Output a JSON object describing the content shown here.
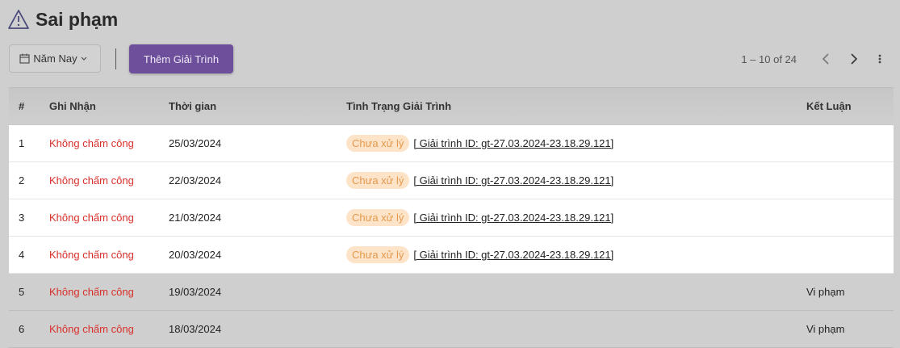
{
  "page": {
    "title": "Sai phạm"
  },
  "toolbar": {
    "year_filter": "Năm Nay",
    "add_button": "Thêm Giải Trình"
  },
  "pagination": {
    "range": "1 – 10 of 24"
  },
  "table": {
    "headers": [
      "#",
      "Ghi Nhận",
      "Thời gian",
      "Tình Trạng Giải Trình",
      "Kết Luận"
    ],
    "rows": [
      {
        "idx": "1",
        "note": "Không chấm công",
        "time": "25/03/2024",
        "status": "Chưa xử lý",
        "link": "[ Giải trình ID: gt-27.03.2024-23.18.29.121]",
        "conclusion": ""
      },
      {
        "idx": "2",
        "note": "Không chấm công",
        "time": "22/03/2024",
        "status": "Chưa xử lý",
        "link": "[ Giải trình ID: gt-27.03.2024-23.18.29.121]",
        "conclusion": ""
      },
      {
        "idx": "3",
        "note": "Không chấm công",
        "time": "21/03/2024",
        "status": "Chưa xử lý",
        "link": "[ Giải trình ID: gt-27.03.2024-23.18.29.121]",
        "conclusion": ""
      },
      {
        "idx": "4",
        "note": "Không chấm công",
        "time": "20/03/2024",
        "status": "Chưa xử lý",
        "link": "[ Giải trình ID: gt-27.03.2024-23.18.29.121]",
        "conclusion": ""
      },
      {
        "idx": "5",
        "note": "Không chấm công",
        "time": "19/03/2024",
        "status": "",
        "link": "",
        "conclusion": "Vi phạm"
      },
      {
        "idx": "6",
        "note": "Không chấm công",
        "time": "18/03/2024",
        "status": "",
        "link": "",
        "conclusion": "Vi phạm"
      }
    ]
  },
  "colors": {
    "accent": "#6e4f9c",
    "violation_text": "#d9302b",
    "badge_bg": "#fde3c8",
    "badge_text": "#e59a4e"
  }
}
